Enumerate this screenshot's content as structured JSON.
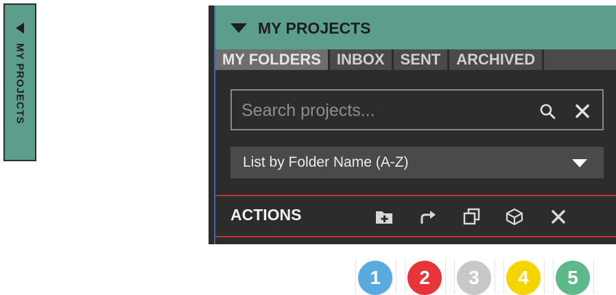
{
  "side_tab": {
    "label": "MY PROJECTS"
  },
  "panel": {
    "title": "MY PROJECTS",
    "tabs": [
      {
        "label": "MY FOLDERS",
        "active": true
      },
      {
        "label": "INBOX",
        "active": false
      },
      {
        "label": "SENT",
        "active": false
      },
      {
        "label": "ARCHIVED",
        "active": false
      }
    ],
    "search": {
      "placeholder": "Search projects...",
      "value": ""
    },
    "sort": {
      "selected": "List by Folder Name (A-Z)"
    },
    "actions": {
      "title": "ACTIONS",
      "buttons": [
        "add-folder-icon",
        "share-icon",
        "duplicate-icon",
        "package-icon",
        "close-icon"
      ]
    }
  },
  "callouts": [
    {
      "label": "1",
      "color": "#5aaadf"
    },
    {
      "label": "2",
      "color": "#e8353a"
    },
    {
      "label": "3",
      "color": "#c8c8c8"
    },
    {
      "label": "4",
      "color": "#f5d400"
    },
    {
      "label": "5",
      "color": "#5db98a"
    }
  ],
  "colors": {
    "header": "#5a9e8b",
    "panel_bg": "#2c2c2c",
    "divider": "#c0353a"
  }
}
